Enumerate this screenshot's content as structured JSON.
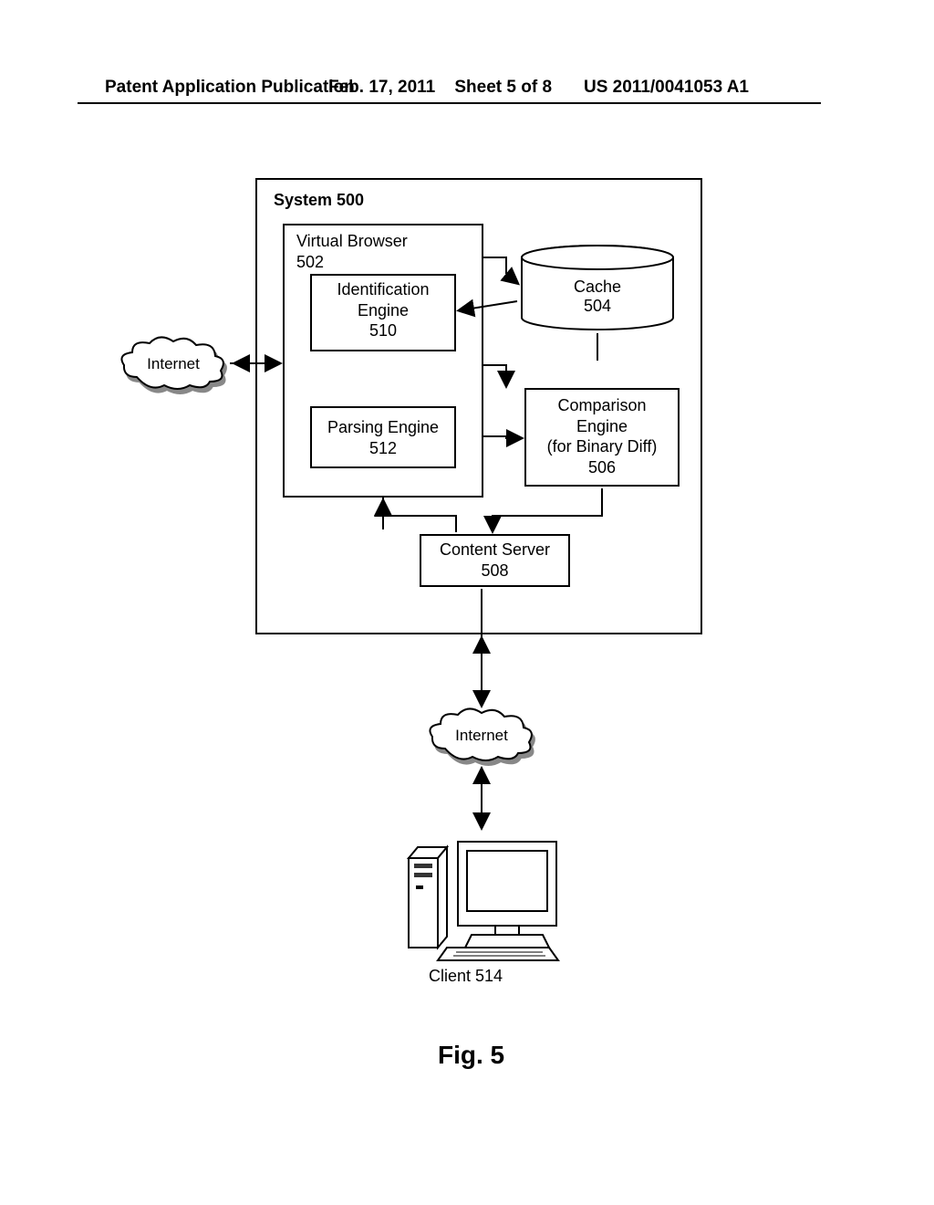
{
  "header": {
    "left": "Patent Application Publication",
    "date": "Feb. 17, 2011",
    "sheet": "Sheet 5 of 8",
    "docnum": "US 2011/0041053 A1"
  },
  "system": {
    "title": "System 500"
  },
  "virtual_browser": {
    "title_line1": "Virtual Browser",
    "title_line2": "502"
  },
  "ident": {
    "line1": "Identification",
    "line2": "Engine",
    "line3": "510"
  },
  "parse": {
    "line1": "Parsing Engine",
    "line2": "512"
  },
  "cache": {
    "line1": "Cache",
    "line2": "504"
  },
  "comparison": {
    "line1": "Comparison",
    "line2": "Engine",
    "line3": "(for Binary Diff)",
    "line4": "506"
  },
  "content_server": {
    "line1": "Content Server",
    "line2": "508"
  },
  "cloud": {
    "label": "Internet"
  },
  "client": {
    "label": "Client 514"
  },
  "figure": {
    "caption": "Fig. 5"
  }
}
